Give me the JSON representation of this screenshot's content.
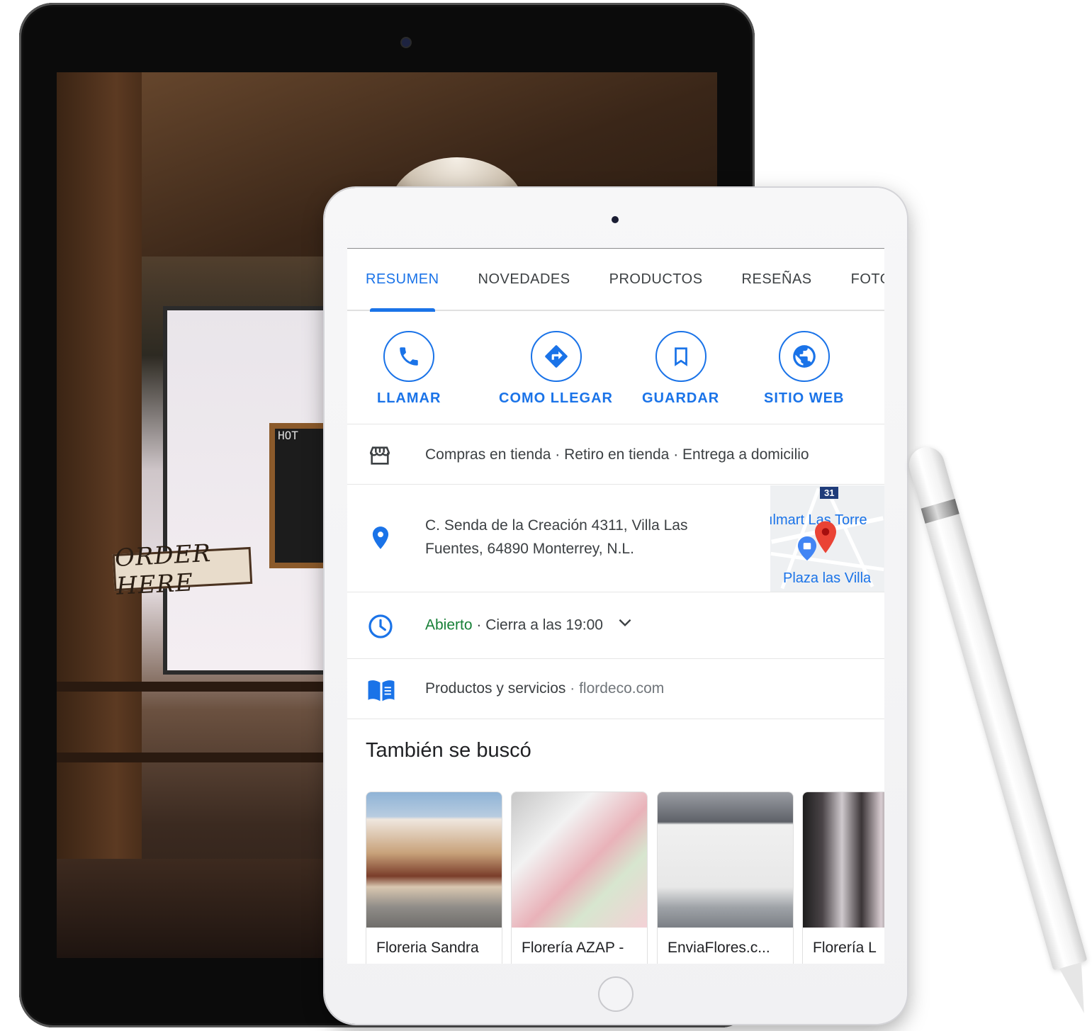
{
  "tabs": [
    {
      "label": "RESUMEN",
      "active": true
    },
    {
      "label": "NOVEDADES",
      "active": false
    },
    {
      "label": "PRODUCTOS",
      "active": false
    },
    {
      "label": "RESEÑAS",
      "active": false
    },
    {
      "label": "FOTOS",
      "active": false
    }
  ],
  "actions": {
    "call": {
      "label": "LLAMAR",
      "icon": "phone-icon"
    },
    "directions": {
      "label": "COMO LLEGAR",
      "icon": "directions-icon"
    },
    "save": {
      "label": "GUARDAR",
      "icon": "bookmark-icon"
    },
    "website": {
      "label": "SITIO WEB",
      "icon": "globe-icon"
    }
  },
  "services": {
    "text": "Compras en tienda · Retiro en tienda · Entrega a domicilio",
    "icon": "store-icon"
  },
  "address": {
    "text": "C. Senda de la Creación 4311, Villa Las Fuentes, 64890 Monterrey, N.L.",
    "icon": "location-pin-icon",
    "map": {
      "label_top": "ılmart Las Torre",
      "label_bottom": "Plaza las Villa",
      "route_badge": "31"
    }
  },
  "hours": {
    "status": "Abierto",
    "detail": " · Cierra a las 19:00",
    "icon": "clock-icon"
  },
  "products": {
    "label": "Productos y servicios",
    "separator": " · ",
    "site": "flordeco.com",
    "icon": "menu-book-icon"
  },
  "also_searched": {
    "title": "También se buscó",
    "items": [
      {
        "name": "Floreria Sandra"
      },
      {
        "name": "Florería AZAP -"
      },
      {
        "name": "EnviaFlores.c..."
      },
      {
        "name": "Florería L"
      }
    ]
  },
  "background_photo": {
    "sign_text": "ORDER HERE",
    "chalkboard_title": "HOT"
  },
  "colors": {
    "accent": "#1a73e8",
    "open": "#188038",
    "text": "#3c4043",
    "muted": "#70757a"
  }
}
